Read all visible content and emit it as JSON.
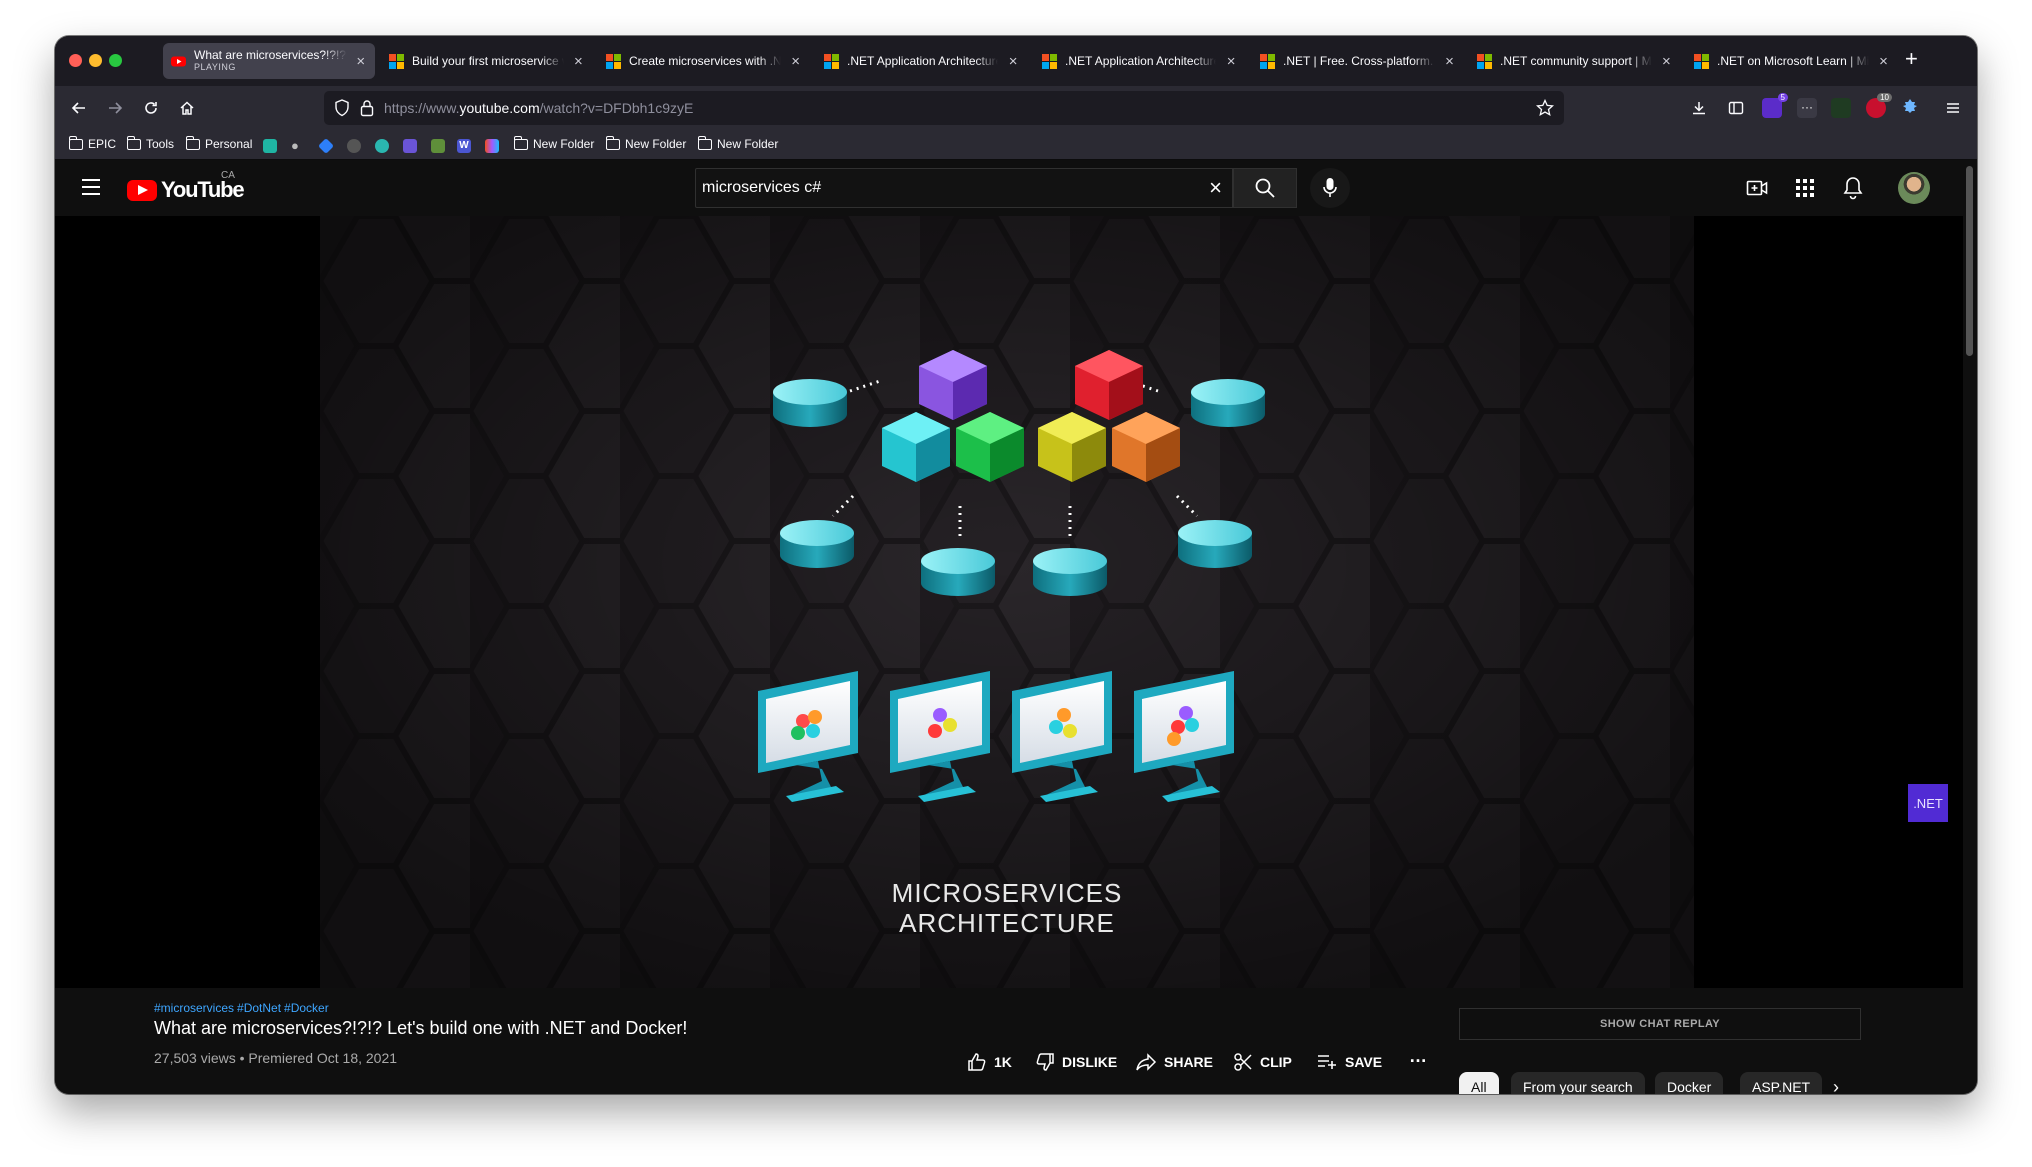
{
  "browser": {
    "tabs": [
      {
        "title": "What are microservices?!?!? Let",
        "subtitle": "PLAYING",
        "icon": "youtube-icon",
        "active": true
      },
      {
        "title": "Build your first microservice wi",
        "icon": "microsoft-icon"
      },
      {
        "title": "Create microservices with .NET",
        "icon": "microsoft-icon"
      },
      {
        "title": ".NET Application Architecture",
        "icon": "microsoft-icon"
      },
      {
        "title": ".NET Application Architecture",
        "icon": "microsoft-icon"
      },
      {
        "title": ".NET | Free. Cross-platform. O",
        "icon": "microsoft-icon"
      },
      {
        "title": ".NET community support | Mic",
        "icon": "microsoft-icon"
      },
      {
        "title": ".NET on Microsoft Learn | Micr",
        "icon": "microsoft-icon"
      }
    ],
    "url_prefix": "https://www.",
    "url_domain": "youtube.com",
    "url_path": "/watch?v=DFDbh1c9zyE",
    "extension_badges": {
      "purple": "5",
      "red": "10"
    },
    "bookmarks": [
      "EPIC",
      "Tools",
      "Personal",
      "New Folder",
      "New Folder",
      "New Folder"
    ]
  },
  "youtube": {
    "logo_text": "YouTube",
    "country": "CA",
    "search_value": "microservices c#",
    "video_overlay_line1": "MICROSERVICES",
    "video_overlay_line2": "ARCHITECTURE",
    "channel_badge": ".NET",
    "tags": [
      "#microservices",
      "#DotNet",
      "#Docker"
    ],
    "title": "What are microservices?!?!? Let's build one with .NET and Docker!",
    "meta": "27,503 views • Premiered Oct 18, 2021",
    "actions": {
      "like": "1K",
      "dislike": "DISLIKE",
      "share": "SHARE",
      "clip": "CLIP",
      "save": "SAVE",
      "more": "…"
    },
    "chat_replay": "SHOW CHAT REPLAY",
    "chips": [
      "All",
      "From your search",
      "Docker",
      "ASP.NET"
    ]
  },
  "colors": {
    "yt_red": "#ff0000",
    "link_blue": "#3ea6ff",
    "dotnet_purple": "#512bd4"
  }
}
